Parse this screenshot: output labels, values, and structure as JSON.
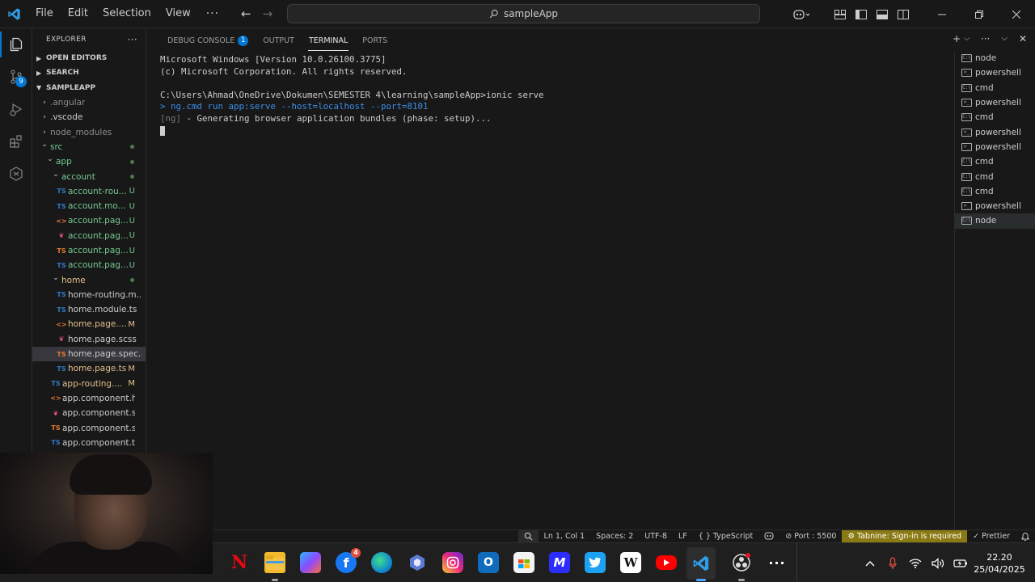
{
  "title_bar": {
    "menu": [
      "File",
      "Edit",
      "Selection",
      "View"
    ],
    "more": "···",
    "search_text": "sampleApp"
  },
  "activity_bar": {
    "scm_badge": "9"
  },
  "explorer": {
    "header": "EXPLORER",
    "header_more": "···",
    "sections": {
      "open_editors": "OPEN EDITORS",
      "search": "SEARCH",
      "project": "SAMPLEAPP"
    },
    "tree": [
      {
        "label": ".angular",
        "kind": "folder-collapsed",
        "depth": 1,
        "color": "dim"
      },
      {
        "label": ".vscode",
        "kind": "folder-collapsed",
        "depth": 1,
        "color": "plain"
      },
      {
        "label": "node_modules",
        "kind": "folder-collapsed",
        "depth": 1,
        "color": "dim"
      },
      {
        "label": "src",
        "kind": "folder-open",
        "depth": 1,
        "color": "green",
        "dot": true
      },
      {
        "label": "app",
        "kind": "folder-open",
        "depth": 2,
        "color": "green",
        "dot": true
      },
      {
        "label": "account",
        "kind": "folder-open",
        "depth": 3,
        "color": "green",
        "dot": true
      },
      {
        "label": "account-rou...",
        "kind": "ts",
        "depth": 4,
        "color": "green",
        "status": "U"
      },
      {
        "label": "account.mo...",
        "kind": "ts",
        "depth": 4,
        "color": "green",
        "status": "U"
      },
      {
        "label": "account.pag...",
        "kind": "html",
        "depth": 4,
        "color": "green",
        "status": "U"
      },
      {
        "label": "account.pag...",
        "kind": "scss",
        "depth": 4,
        "color": "green",
        "status": "U"
      },
      {
        "label": "account.pag...",
        "kind": "ts-red",
        "depth": 4,
        "color": "green",
        "status": "U"
      },
      {
        "label": "account.pag...",
        "kind": "ts",
        "depth": 4,
        "color": "green",
        "status": "U"
      },
      {
        "label": "home",
        "kind": "folder-open",
        "depth": 3,
        "color": "yellow",
        "dot": true
      },
      {
        "label": "home-routing.m...",
        "kind": "ts",
        "depth": 4,
        "color": "plain"
      },
      {
        "label": "home.module.ts",
        "kind": "ts",
        "depth": 4,
        "color": "plain"
      },
      {
        "label": "home.page....",
        "kind": "html",
        "depth": 4,
        "color": "yellow",
        "status": "M"
      },
      {
        "label": "home.page.scss",
        "kind": "scss",
        "depth": 4,
        "color": "plain"
      },
      {
        "label": "home.page.spec.ts",
        "kind": "ts-red",
        "depth": 4,
        "color": "plain",
        "selected": true
      },
      {
        "label": "home.page.ts",
        "kind": "ts",
        "depth": 4,
        "color": "yellow",
        "status": "M"
      },
      {
        "label": "app-routing....",
        "kind": "ts",
        "depth": 3,
        "color": "yellow",
        "status": "M"
      },
      {
        "label": "app.component.ht...",
        "kind": "html",
        "depth": 3,
        "color": "plain"
      },
      {
        "label": "app.component.scss",
        "kind": "scss",
        "depth": 3,
        "color": "plain"
      },
      {
        "label": "app.component.sp...",
        "kind": "ts-red",
        "depth": 3,
        "color": "plain"
      },
      {
        "label": "app.component.ts",
        "kind": "ts",
        "depth": 3,
        "color": "plain"
      }
    ]
  },
  "panel": {
    "tabs": [
      {
        "label": "DEBUG CONSOLE",
        "badge": "1"
      },
      {
        "label": "OUTPUT"
      },
      {
        "label": "TERMINAL",
        "active": true
      },
      {
        "label": "PORTS"
      }
    ],
    "terminal_lines": [
      {
        "text": "Microsoft Windows [Version 10.0.26100.3775]",
        "style": "normal"
      },
      {
        "text": "(c) Microsoft Corporation. All rights reserved.",
        "style": "normal"
      },
      {
        "text": "",
        "style": "normal"
      },
      {
        "text": "C:\\Users\\Ahmad\\OneDrive\\Dokumen\\SEMESTER 4\\learning\\sampleApp>ionic serve",
        "style": "normal"
      },
      {
        "text": "> ng.cmd run app:serve --host=localhost --port=8101",
        "style": "blue"
      },
      {
        "prefix": "[ng]",
        "text": " - Generating browser application bundles (phase: setup)...",
        "style": "ng"
      }
    ],
    "terminals": [
      {
        "name": "node",
        "type": "cmd"
      },
      {
        "name": "powershell",
        "type": "ps"
      },
      {
        "name": "cmd",
        "type": "cmd"
      },
      {
        "name": "powershell",
        "type": "ps"
      },
      {
        "name": "cmd",
        "type": "cmd"
      },
      {
        "name": "powershell",
        "type": "ps"
      },
      {
        "name": "powershell",
        "type": "ps"
      },
      {
        "name": "cmd",
        "type": "cmd"
      },
      {
        "name": "cmd",
        "type": "cmd"
      },
      {
        "name": "cmd",
        "type": "cmd"
      },
      {
        "name": "powershell",
        "type": "ps"
      },
      {
        "name": "node",
        "type": "cmd",
        "selected": true
      }
    ]
  },
  "status_bar": {
    "position": "Ln 1, Col 1",
    "spaces": "Spaces: 2",
    "encoding": "UTF-8",
    "eol": "LF",
    "language": "TypeScript",
    "port": "Port : 5500",
    "tabnine": "Tabnine: Sign-in is required",
    "prettier": "Prettier"
  },
  "taskbar": {
    "time": "22.20",
    "date": "25/04/2025",
    "facebook_badge": "4"
  },
  "colors": {
    "accent": "#0078d4",
    "untracked": "#73c991",
    "modified": "#e2c08d",
    "warning_bg": "#8a7a14"
  }
}
